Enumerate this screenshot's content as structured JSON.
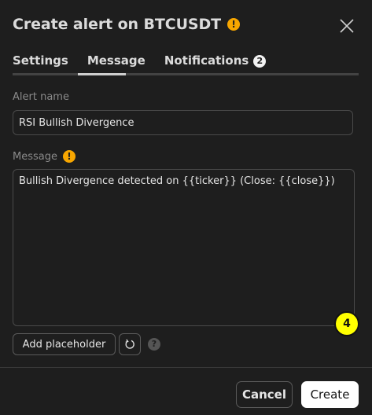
{
  "dialog": {
    "title": "Create alert on BTCUSDT",
    "title_warning_icon": "warning-icon",
    "close_icon": "close-icon"
  },
  "tabs": [
    {
      "label": "Settings",
      "active": false
    },
    {
      "label": "Message",
      "active": true
    },
    {
      "label": "Notifications",
      "active": false,
      "badge": "2"
    }
  ],
  "alert_name": {
    "label": "Alert name",
    "value": "RSI Bullish Divergence"
  },
  "message": {
    "label": "Message",
    "value": "Bullish Divergence detected on {{ticker}} (Close: {{close}})"
  },
  "step_marker": "4",
  "placeholder_row": {
    "add_placeholder_label": "Add placeholder",
    "reset_icon": "reset-icon",
    "help_icon": "help-icon",
    "help_glyph": "?"
  },
  "footer": {
    "cancel_label": "Cancel",
    "create_label": "Create"
  },
  "colors": {
    "background": "#1e1e1e",
    "warning": "#f7a600",
    "marker": "#ffff00",
    "primary_button": "#ffffff"
  }
}
